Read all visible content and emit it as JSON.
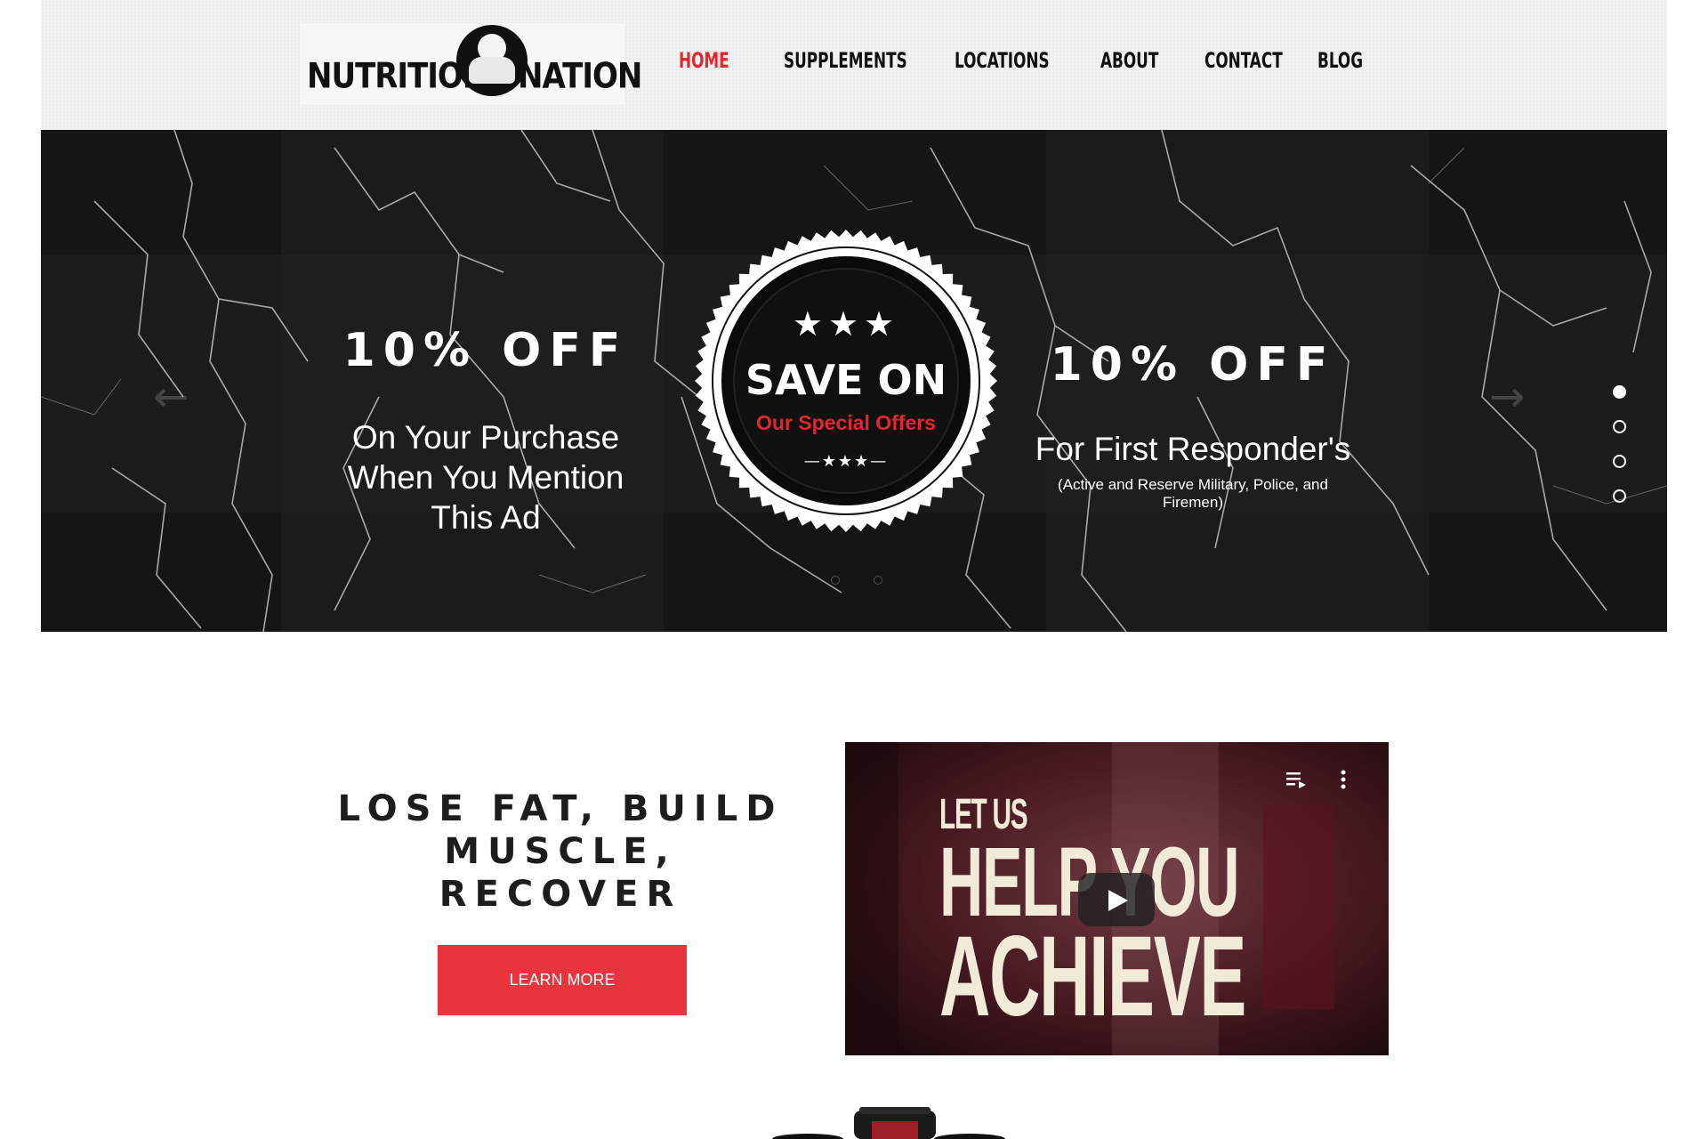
{
  "brand": {
    "logo_left": "NUTRITION",
    "logo_right": "NATION"
  },
  "nav": {
    "items": [
      {
        "label": "HOME",
        "active": true
      },
      {
        "label": "SUPPLEMENTS",
        "active": false
      },
      {
        "label": "LOCATIONS",
        "active": false
      },
      {
        "label": "ABOUT",
        "active": false
      },
      {
        "label": "CONTACT",
        "active": false
      },
      {
        "label": "BLOG",
        "active": false
      }
    ]
  },
  "hero": {
    "left_offer": {
      "heading": "10% OFF",
      "lines": [
        "On Your Purchase",
        "When You Mention",
        "This Ad"
      ]
    },
    "badge": {
      "stars_top": "★★★",
      "title": "SAVE ON",
      "subtitle": "Our Special Offers",
      "stars_bottom": "—★★★—"
    },
    "right_offer": {
      "heading": "10% OFF",
      "line": "For First Responder's",
      "fine_print": [
        "(Active and Reserve Military, Police, and",
        "Firemen)"
      ]
    },
    "slide_count": 4,
    "active_slide": 1,
    "prev_icon": "arrow-left-icon",
    "next_icon": "arrow-right-icon"
  },
  "promo": {
    "tagline_lines": [
      "LOSE FAT, BUILD",
      "MUSCLE, RECOVER"
    ],
    "cta_label": "LEARN MORE"
  },
  "video": {
    "title_lines": [
      "LET US",
      "HELP YOU",
      "ACHIEVE"
    ],
    "play_icon": "play-icon",
    "playlist_icon": "playlist-icon",
    "menu_icon": "more-vertical-icon"
  },
  "colors": {
    "accent": "#e4262d",
    "button": "#e8343c",
    "text_dark": "#1d1d1d"
  }
}
